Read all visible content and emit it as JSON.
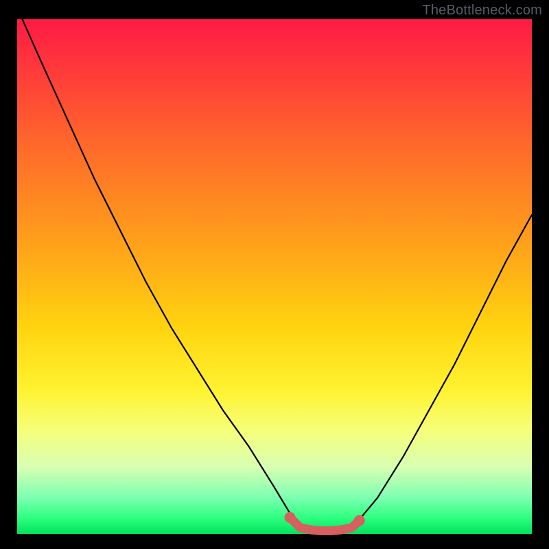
{
  "attribution": "TheBottleneck.com",
  "colors": {
    "page_bg": "#000000",
    "curve_stroke": "#000000",
    "bead_fill": "#d6605f",
    "bead_stroke": "#b04a48"
  },
  "chart_data": {
    "type": "line",
    "title": "",
    "xlabel": "",
    "ylabel": "",
    "xlim": [
      0,
      100
    ],
    "ylim": [
      0,
      100
    ],
    "series": [
      {
        "name": "left-branch",
        "x": [
          1,
          5,
          10,
          15,
          20,
          25,
          30,
          35,
          40,
          45,
          50,
          53,
          55
        ],
        "y": [
          100,
          91,
          80,
          69,
          59,
          49,
          40,
          32,
          24,
          17,
          9,
          4,
          1
        ]
      },
      {
        "name": "valley-floor",
        "x": [
          55,
          57,
          59,
          61,
          63,
          65
        ],
        "y": [
          1,
          0.7,
          0.6,
          0.6,
          0.7,
          1
        ]
      },
      {
        "name": "right-branch",
        "x": [
          65,
          70,
          75,
          80,
          85,
          90,
          95,
          100
        ],
        "y": [
          1,
          7,
          15,
          24,
          33,
          43,
          53,
          62
        ]
      }
    ],
    "annotations": {
      "bead_strip": {
        "note": "short thick red segment tracing the valley floor with round endpoints",
        "x": [
          53,
          55,
          57,
          59,
          61,
          63,
          65,
          66.5
        ],
        "y": [
          3.2,
          1.2,
          0.8,
          0.6,
          0.6,
          0.8,
          1.2,
          2.6
        ]
      }
    }
  }
}
